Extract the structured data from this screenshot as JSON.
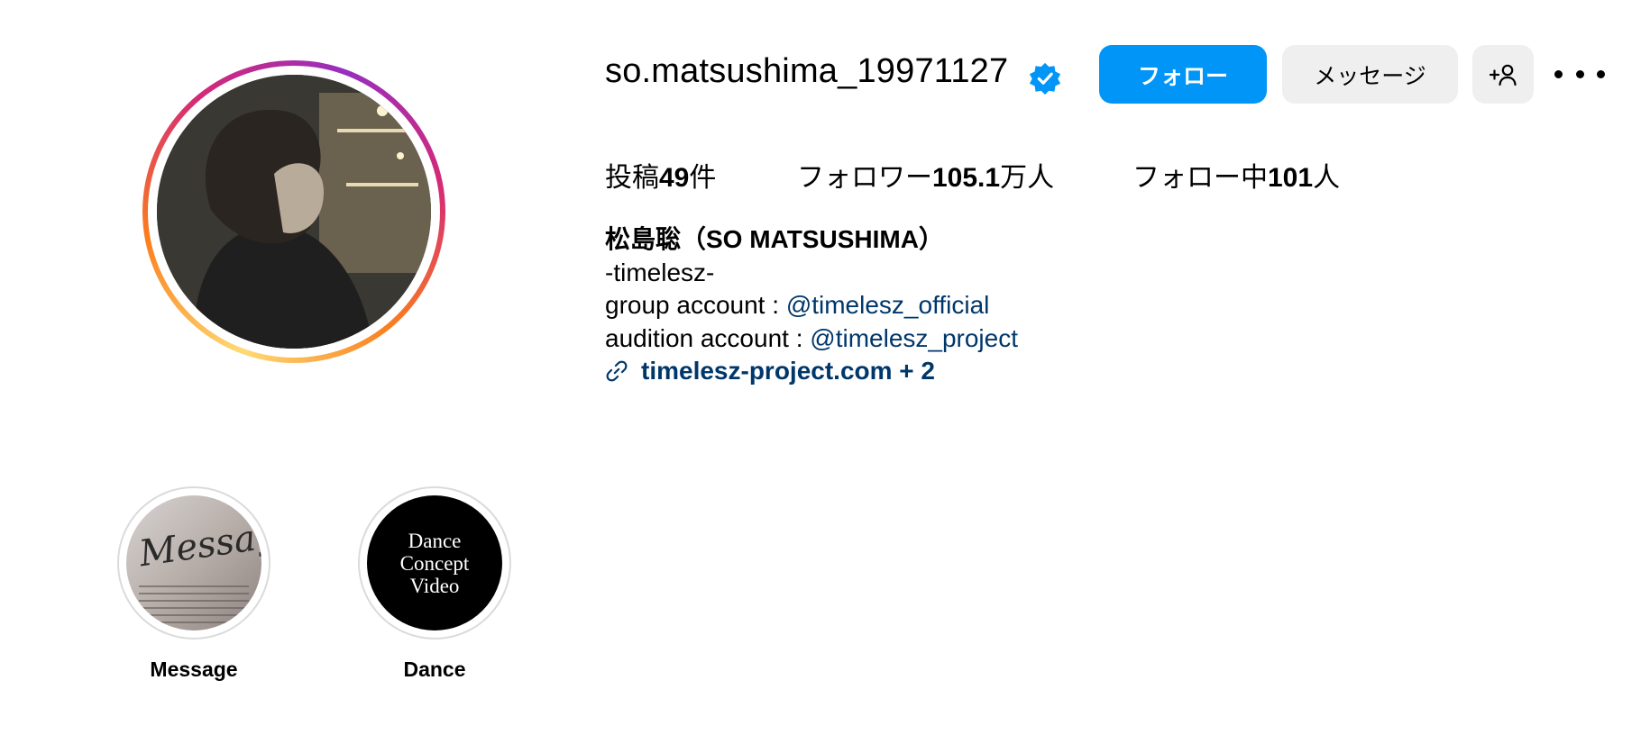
{
  "profile": {
    "username": "so.matsushima_19971127",
    "verified": true,
    "follow_label": "フォロー",
    "message_label": "メッセージ",
    "add_user_icon": "person-plus-icon",
    "more_icon": "more-horizontal-icon"
  },
  "stats": {
    "posts_label": "投稿",
    "posts_count": "49",
    "posts_suffix": "件",
    "followers_label": "フォロワー",
    "followers_count": "105.1",
    "followers_suffix": "万人",
    "following_label": "フォロー中",
    "following_count": "101",
    "following_suffix": "人"
  },
  "bio": {
    "name": "松島聡（SO MATSUSHIMA）",
    "line1": "-timelesz-",
    "group_prefix": "group account : ",
    "group_mention": "@timelesz_official",
    "audition_prefix": "audition account : ",
    "audition_mention": "@timelesz_project",
    "link_text": "timelesz-project.com + 2",
    "link_icon": "link-icon"
  },
  "highlights": [
    {
      "label": "Message",
      "cover_text": "Message"
    },
    {
      "label": "Dance",
      "cover_text": "Dance\nConcept\nVideo"
    }
  ],
  "colors": {
    "accent": "#0095f6",
    "link": "#00376b",
    "button_gray": "#efefef"
  }
}
